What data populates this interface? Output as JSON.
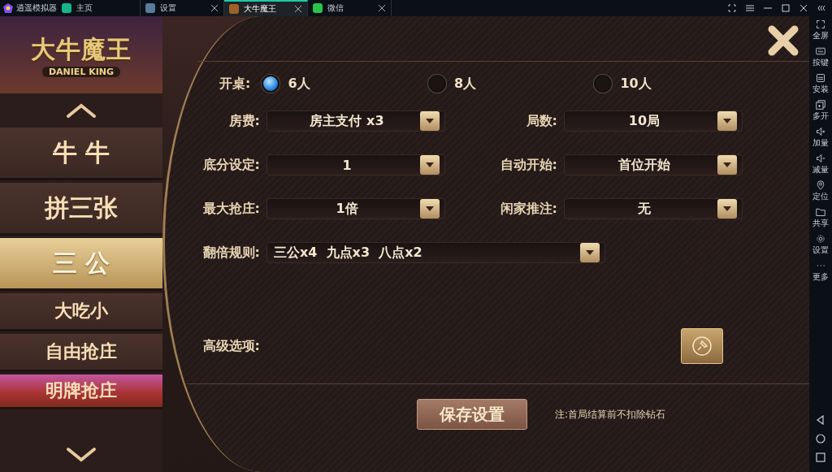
{
  "emulator": {
    "app_name": "逍遥模拟器",
    "tabs": [
      {
        "label": "主页",
        "selected": false,
        "closable": false
      },
      {
        "label": "设置",
        "selected": false,
        "closable": true
      },
      {
        "label": "大牛魔王",
        "selected": true,
        "closable": true
      },
      {
        "label": "微信",
        "selected": false,
        "closable": true
      }
    ]
  },
  "side_toolbar": [
    {
      "label": "全屏"
    },
    {
      "label": "按键"
    },
    {
      "label": "安装"
    },
    {
      "label": "多开"
    },
    {
      "label": "加量"
    },
    {
      "label": "减量"
    },
    {
      "label": "定位"
    },
    {
      "label": "共享"
    },
    {
      "label": "设置"
    },
    {
      "label": "更多"
    }
  ],
  "game": {
    "logo": {
      "title": "大牛魔王",
      "subtitle": "DANIEL KING"
    },
    "games": [
      {
        "label": "牛 牛",
        "kind": "large",
        "selected": false
      },
      {
        "label": "拼三张",
        "kind": "large",
        "selected": false
      },
      {
        "label": "三 公",
        "kind": "large",
        "selected": true
      },
      {
        "label": "大吃小",
        "kind": "small",
        "selected": false
      },
      {
        "label": "自由抢庄",
        "kind": "small",
        "selected": false
      },
      {
        "label": "明牌抢庄",
        "kind": "featured",
        "selected": false
      }
    ],
    "settings": {
      "table_size": {
        "label": "开桌:",
        "options": [
          {
            "label": "6人",
            "selected": true
          },
          {
            "label": "8人",
            "selected": false
          },
          {
            "label": "10人",
            "selected": false
          }
        ]
      },
      "rows": [
        [
          {
            "label": "房费:",
            "value": "房主支付 x3"
          },
          {
            "label": "局数:",
            "value": "10局"
          }
        ],
        [
          {
            "label": "底分设定:",
            "value": "1"
          },
          {
            "label": "自动开始:",
            "value": "首位开始"
          }
        ],
        [
          {
            "label": "最大抢庄:",
            "value": "1倍"
          },
          {
            "label": "闲家推注:",
            "value": "无"
          }
        ]
      ],
      "double_rule": {
        "label": "翻倍规则:",
        "value": "三公x4  九点x3  八点x2"
      },
      "advanced": {
        "label": "高级选项:"
      },
      "save_button": "保存设置",
      "note": "注:首局结算前不扣除钻石"
    }
  }
}
